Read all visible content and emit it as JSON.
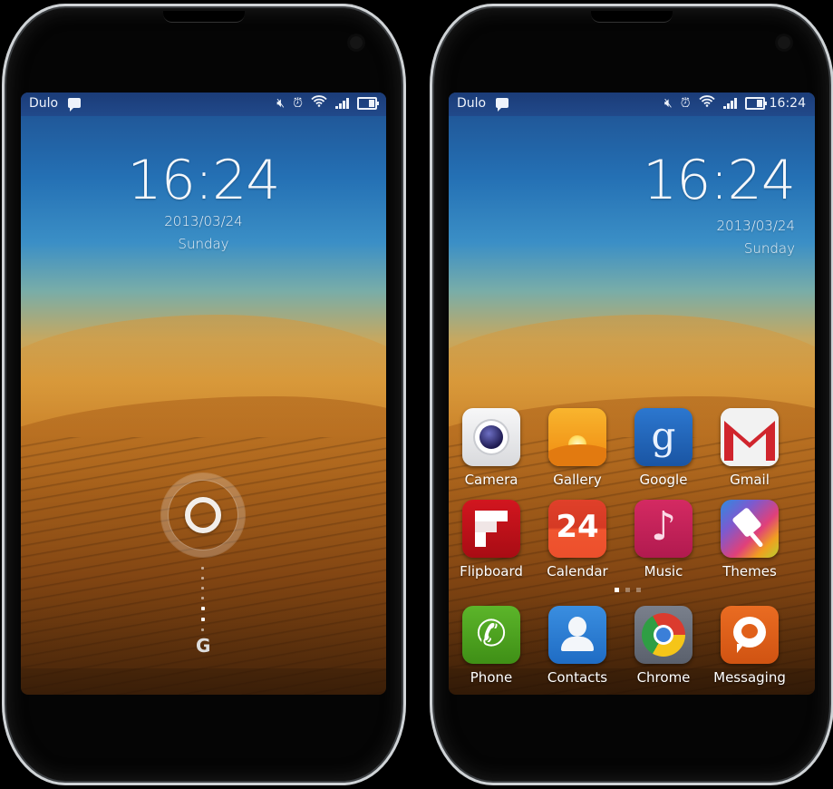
{
  "lock_screen": {
    "status_bar": {
      "carrier": "Dulo",
      "notification_icon": "message-icon",
      "icons": [
        "mute-icon",
        "alarm-icon",
        "wifi-icon",
        "signal-icon",
        "battery-icon"
      ]
    },
    "clock": {
      "time": "16:24",
      "date": "2013/03/24",
      "day": "Sunday"
    },
    "unlock_hint_glyph": "G",
    "unlock_track": {
      "total_dots": 7,
      "highlighted": [
        4,
        5
      ]
    }
  },
  "home_screen": {
    "status_bar": {
      "carrier": "Dulo",
      "notification_icon": "message-icon",
      "icons": [
        "mute-icon",
        "alarm-icon",
        "wifi-icon",
        "signal-icon",
        "battery-icon"
      ],
      "time": "16:24"
    },
    "clock": {
      "time": "16:24",
      "date": "2013/03/24",
      "day": "Sunday"
    },
    "apps": [
      {
        "label": "Camera",
        "icon": "camera-icon",
        "color": "#e8e9ec"
      },
      {
        "label": "Gallery",
        "icon": "gallery-icon",
        "color": "#f39c12"
      },
      {
        "label": "Google",
        "icon": "google-icon",
        "color": "#1f62b4"
      },
      {
        "label": "Gmail",
        "icon": "gmail-icon",
        "color": "#f2f2f2"
      },
      {
        "label": "Flipboard",
        "icon": "flipboard-icon",
        "color": "#c0121b",
        "glyph": "F"
      },
      {
        "label": "Calendar",
        "icon": "calendar-icon",
        "color": "#e8472a",
        "glyph": "24"
      },
      {
        "label": "Music",
        "icon": "music-icon",
        "color": "#c61e5a",
        "glyph": "♪"
      },
      {
        "label": "Themes",
        "icon": "themes-icon",
        "color": "#7a5cc8"
      }
    ],
    "page_indicator": {
      "pages": 3,
      "current": 1
    },
    "dock": [
      {
        "label": "Phone",
        "icon": "phone-icon",
        "color": "#4aa31e",
        "glyph": "✆"
      },
      {
        "label": "Contacts",
        "icon": "contacts-icon",
        "color": "#2b7fd6"
      },
      {
        "label": "Chrome",
        "icon": "chrome-icon",
        "color": "#6c7280"
      },
      {
        "label": "Messaging",
        "icon": "messaging-icon",
        "color": "#e0601a"
      }
    ]
  }
}
